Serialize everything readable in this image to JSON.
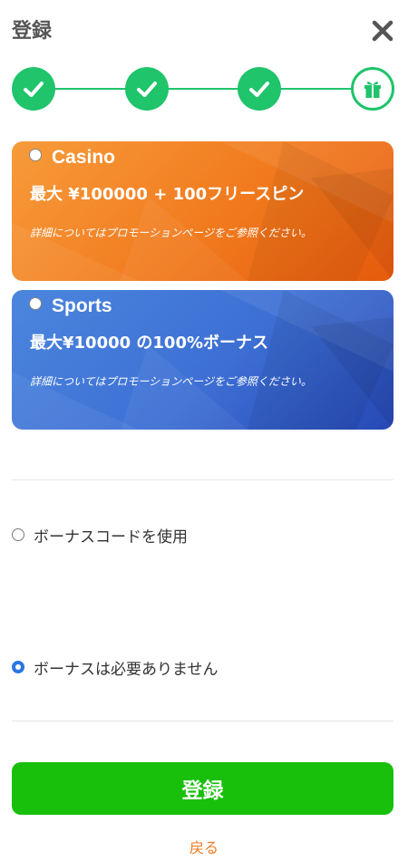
{
  "header": {
    "title": "登録"
  },
  "steps": [
    {
      "state": "done",
      "icon": "check-icon"
    },
    {
      "state": "done",
      "icon": "check-icon"
    },
    {
      "state": "done",
      "icon": "check-icon"
    },
    {
      "state": "current",
      "icon": "gift-icon"
    }
  ],
  "bonuses": [
    {
      "name": "Casino",
      "offer": "最大 ¥100000 + 100フリースピン",
      "note": "詳細についてはプロモーションページをご参照ください。",
      "selected": false
    },
    {
      "name": "Sports",
      "offer": "最大¥10000 の100%ボーナス",
      "note": "詳細についてはプロモーションページをご参照ください。",
      "selected": false
    }
  ],
  "options": [
    {
      "label": "ボーナスコードを使用",
      "selected": false
    },
    {
      "label": "ボーナスは必要ありません",
      "selected": true
    }
  ],
  "actions": {
    "submit_label": "登録",
    "back_label": "戻る"
  },
  "colors": {
    "accent_green": "#1fc46b",
    "submit_green": "#18c00b",
    "casino_orange": "#f17a1e",
    "sports_blue": "#3d6fd4",
    "link_orange": "#f07a20"
  }
}
